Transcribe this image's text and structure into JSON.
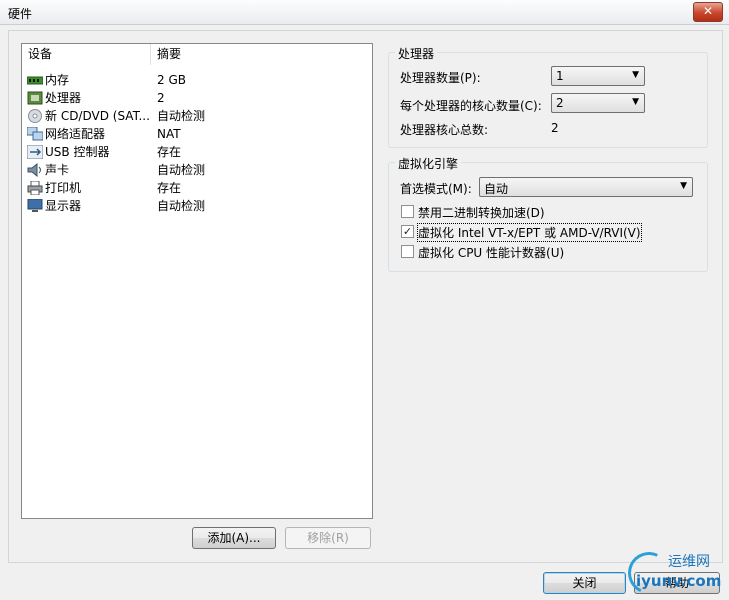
{
  "window": {
    "title": "硬件",
    "close_glyph": "✕"
  },
  "device_list": {
    "columns": [
      "设备",
      "摘要"
    ],
    "rows": [
      {
        "name": "内存",
        "summary": "2 GB",
        "icon": "memory-icon"
      },
      {
        "name": "处理器",
        "summary": "2",
        "icon": "processor-icon"
      },
      {
        "name": "新 CD/DVD (SAT...",
        "summary": "自动检测",
        "icon": "cd-dvd-icon"
      },
      {
        "name": "网络适配器",
        "summary": "NAT",
        "icon": "network-adapter-icon"
      },
      {
        "name": "USB 控制器",
        "summary": "存在",
        "icon": "usb-icon"
      },
      {
        "name": "声卡",
        "summary": "自动检测",
        "icon": "sound-card-icon"
      },
      {
        "name": "打印机",
        "summary": "存在",
        "icon": "printer-icon"
      },
      {
        "name": "显示器",
        "summary": "自动检测",
        "icon": "display-icon"
      }
    ]
  },
  "processor": {
    "group_title": "处理器",
    "count_label": "处理器数量(P):",
    "count_value": "1",
    "cores_label": "每个处理器的核心数量(C):",
    "cores_value": "2",
    "total_label": "处理器核心总数:",
    "total_value": "2"
  },
  "virtualization": {
    "group_title": "虚拟化引擎",
    "mode_label": "首选模式(M):",
    "mode_value": "自动",
    "options": [
      {
        "label": "禁用二进制转换加速(D)",
        "checked": false
      },
      {
        "label": "虚拟化 Intel VT-x/EPT 或 AMD-V/RVI(V)",
        "checked": true
      },
      {
        "label": "虚拟化 CPU 性能计数器(U)",
        "checked": false
      }
    ]
  },
  "buttons": {
    "add": "添加(A)...",
    "remove": "移除(R)",
    "close": "关闭",
    "help": "帮助"
  },
  "watermark": {
    "cn": "运维网",
    "url": "iyunv.com"
  }
}
